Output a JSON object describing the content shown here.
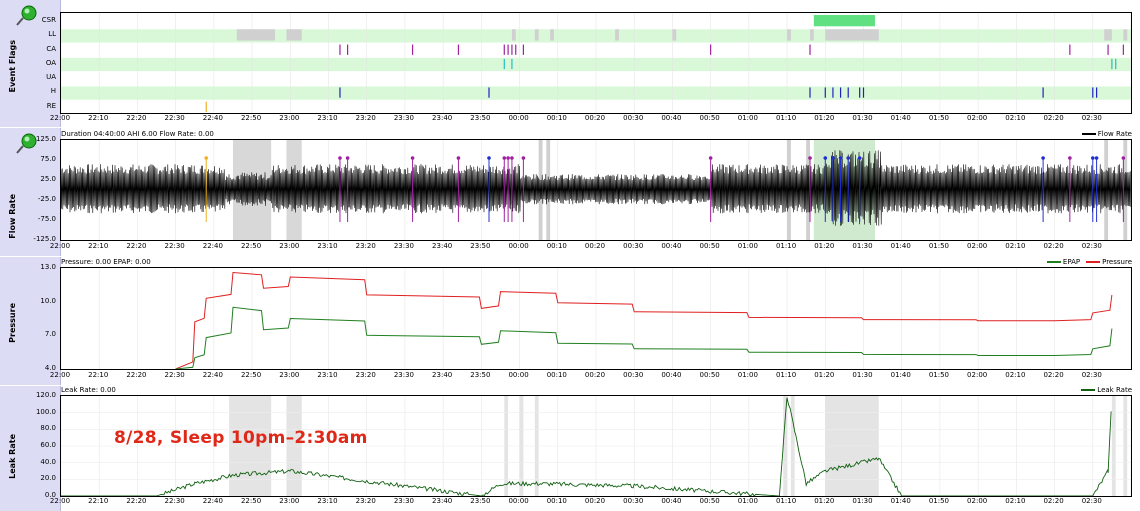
{
  "panels": {
    "events": {
      "title": "Event Flags",
      "rows": [
        "CSR",
        "LL",
        "CA",
        "OA",
        "UA",
        "H",
        "RE"
      ]
    },
    "flow": {
      "title": "Flow Rate",
      "header": "Duration 04:40:00 AHI 6.00 Flow Rate: 0.00",
      "legend": "Flow Rate",
      "yticks": [
        "125.0",
        "75.0",
        "25.0",
        "-25.0",
        "-75.0",
        "-125.0"
      ]
    },
    "pressure": {
      "title": "Pressure",
      "header": "Pressure: 0.00 EPAP: 0.00",
      "legend_a": "EPAP",
      "legend_b": "Pressure",
      "yticks": [
        "13.0",
        "10.0",
        "7.0",
        "4.0"
      ]
    },
    "leak": {
      "title": "Leak Rate",
      "header": "Leak Rate: 0.00",
      "legend": "Leak Rate",
      "yticks": [
        "120.0",
        "100.0",
        "80.0",
        "60.0",
        "40.0",
        "20.0",
        "0.0"
      ]
    }
  },
  "time_ticks": [
    "22:00",
    "22:10",
    "22:20",
    "22:30",
    "22:40",
    "22:50",
    "23:00",
    "23:10",
    "23:20",
    "23:30",
    "23:40",
    "23:50",
    "00:00",
    "00:10",
    "00:20",
    "00:30",
    "00:40",
    "00:50",
    "01:00",
    "01:10",
    "01:20",
    "01:30",
    "01:40",
    "01:50",
    "02:00",
    "02:10",
    "02:20",
    "02:30"
  ],
  "annotation": "8/28, Sleep 10pm–2:30am",
  "colors": {
    "pressure": "#e02020",
    "epap": "#208020",
    "leak": "#106010",
    "flow": "#000000",
    "event_row": "#d8f8d8",
    "csr": "#60e080",
    "shade": "#d0d0d0"
  },
  "chart_data": [
    {
      "type": "line",
      "title": "Pressure",
      "x": [
        "22:30",
        "22:35",
        "22:38",
        "22:45",
        "22:53",
        "23:00",
        "23:20",
        "23:50",
        "23:55",
        "00:10",
        "00:30",
        "01:00",
        "01:30",
        "02:00",
        "02:20",
        "02:30",
        "02:35"
      ],
      "series": [
        {
          "name": "Pressure",
          "values": [
            4.0,
            8.2,
            10.3,
            12.6,
            11.2,
            12.2,
            10.6,
            9.4,
            10.9,
            9.9,
            9.1,
            8.6,
            8.4,
            8.3,
            8.3,
            9.0,
            10.6
          ]
        },
        {
          "name": "EPAP",
          "values": [
            4.0,
            5.0,
            6.8,
            9.5,
            7.5,
            8.5,
            7.0,
            6.2,
            7.4,
            6.3,
            5.8,
            5.5,
            5.3,
            5.2,
            5.2,
            5.8,
            7.6
          ]
        }
      ],
      "ylim": [
        4.0,
        13.0
      ]
    },
    {
      "type": "line",
      "title": "Leak Rate",
      "x": [
        "22:00",
        "22:25",
        "22:35",
        "22:45",
        "23:00",
        "23:50",
        "23:55",
        "00:05",
        "00:30",
        "01:08",
        "01:10",
        "01:15",
        "01:20",
        "01:34",
        "01:40",
        "02:30",
        "02:34",
        "02:35"
      ],
      "series": [
        {
          "name": "Leak Rate",
          "values": [
            0,
            0,
            15,
            25,
            30,
            0,
            15,
            15,
            12,
            0,
            120,
            15,
            30,
            45,
            0,
            0,
            30,
            120
          ]
        }
      ],
      "ylim": [
        0,
        120
      ]
    }
  ]
}
